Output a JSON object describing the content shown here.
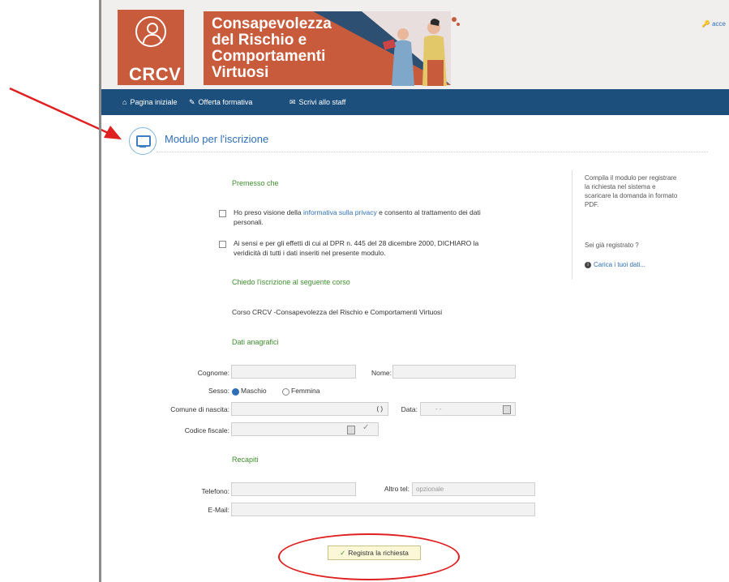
{
  "header": {
    "logo_text": "CRCV",
    "title_lines": [
      "Consapevolezza",
      "del Rischio e",
      "Comportamenti",
      "Virtuosi"
    ],
    "login_label": "acce"
  },
  "nav": {
    "items": [
      {
        "label": "Pagina iniziale",
        "icon": "home-icon"
      },
      {
        "label": "Offerta formativa",
        "icon": "graduation-icon"
      },
      {
        "label": "Scrivi allo staff",
        "icon": "mail-icon"
      }
    ]
  },
  "section": {
    "title": "Modulo per l'iscrizione"
  },
  "form": {
    "premesso": "Premesso che",
    "privacy_pre": "Ho preso visione della ",
    "privacy_link": "informativa sulla privacy",
    "privacy_post": " e consento al trattamento dei dati",
    "privacy_line2": "personali.",
    "dpr_line1": "Ai sensi e per gli effetti di cui al DPR n. 445 del 28 dicembre 2000, DICHIARO la",
    "dpr_line2": "veridicità di tutti i dati inseriti nel presente modulo.",
    "chiedo": "Chiedo l'iscrizione al seguente corso",
    "course": "Corso CRCV -Consapevolezza del Rischio e Comportamenti Virtuosi",
    "dati_anagrafici": "Dati anagrafici",
    "cognome_label": "Cognome:",
    "nome_label": "Nome:",
    "sesso_label": "Sesso:",
    "maschio": "Maschio",
    "femmina": "Femmina",
    "comune_label": "Comune di nascita:",
    "comune_parens": "(      )",
    "data_label": "Data:",
    "data_sep": "-        -",
    "cf_label": "Codice fiscale:",
    "recapiti": "Recapiti",
    "telefono_label": "Telefono:",
    "altro_tel_label": "Altro tel:",
    "altro_tel_placeholder": "opzionale",
    "email_label": "E-Mail:",
    "submit_label": "Registra la richiesta"
  },
  "sidebar": {
    "help_lines": [
      "Compila il modulo per registrare",
      "la richiesta nel sistema e",
      "scaricare la domanda in formato",
      "PDF."
    ],
    "registered_question": "Sei già registrato ?",
    "load_link": "Carica i tuoi dati..."
  },
  "colors": {
    "brand_orange": "#c85b3c",
    "nav_blue": "#1d4f7d",
    "green_heading": "#3f8f2e",
    "link_blue": "#2f6fb8",
    "annotation_red": "#e02020"
  }
}
